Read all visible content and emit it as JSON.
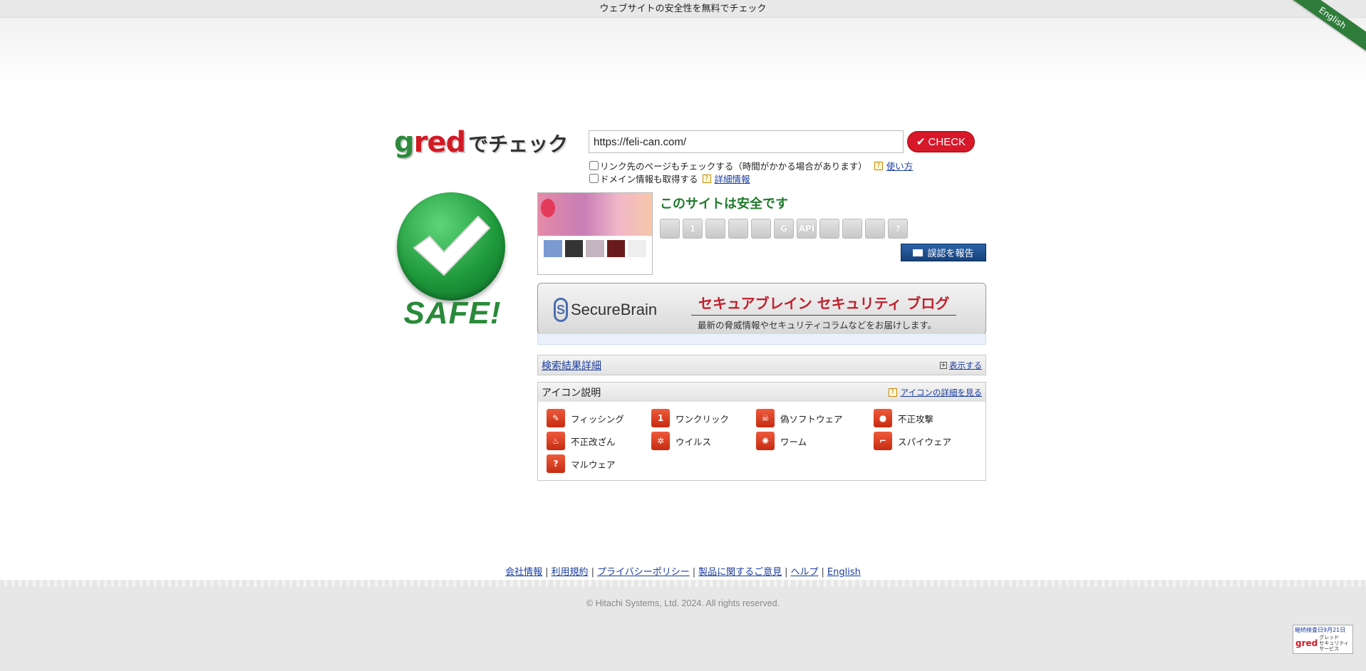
{
  "header": {
    "tagline": "ウェブサイトの安全性を無料でチェック",
    "language_ribbon": "English"
  },
  "logo": {
    "g": "g",
    "red": "red",
    "de": "でチェック"
  },
  "search": {
    "url_value": "https://feli-can.com/",
    "check_label": "CHECK",
    "option1_label": "リンク先のページもチェックする（時間がかかる場合があります）",
    "option1_help": "使い方",
    "option2_label": "ドメイン情報も取得する",
    "option2_help": "詳細情報"
  },
  "result": {
    "safe_text": "SAFE!",
    "message": "このサイトは安全です",
    "report_label": "誤認を報告",
    "status_icons": [
      "phishing-icon",
      "one-click-icon",
      "fake-software-icon",
      "attack-icon",
      "tamper-icon",
      "g-icon",
      "api-icon",
      "virus-icon",
      "worm-icon",
      "spyware-icon",
      "malware-icon"
    ],
    "status_icon_labels": [
      "",
      "1",
      "",
      "",
      "",
      "G",
      "API",
      "",
      "",
      "",
      "?"
    ]
  },
  "banner": {
    "brand": "SecureBrain",
    "title": "セキュアブレイン セキュリティ ブログ",
    "subtitle": "最新の脅威情報やセキュリティコラムなどをお届けします。"
  },
  "details_panel": {
    "title": "検索結果詳細",
    "toggle": "表示する"
  },
  "legend_panel": {
    "title": "アイコン説明",
    "detail_link": "アイコンの詳細を見る",
    "items": [
      {
        "label": "フィッシング",
        "glyph": "✎"
      },
      {
        "label": "ワンクリック",
        "glyph": "1"
      },
      {
        "label": "偽ソフトウェア",
        "glyph": "☠"
      },
      {
        "label": "不正攻撃",
        "glyph": "●"
      },
      {
        "label": "不正改ざん",
        "glyph": "♨"
      },
      {
        "label": "ウイルス",
        "glyph": "✲"
      },
      {
        "label": "ワーム",
        "glyph": "✺"
      },
      {
        "label": "スパイウェア",
        "glyph": "⌐"
      },
      {
        "label": "マルウェア",
        "glyph": "?"
      }
    ]
  },
  "footer": {
    "links": [
      "会社情報",
      "利用規約",
      "プライバシーポリシー",
      "製品に関するご意見",
      "ヘルプ",
      "English"
    ],
    "copyright": "© Hitachi Systems, Ltd. 2024. All rights reserved.",
    "seal_top": "継続検査日9月21日",
    "seal_mark": "gred",
    "seal_name1": "グレッド",
    "seal_name2": "セキュリティサービス"
  }
}
